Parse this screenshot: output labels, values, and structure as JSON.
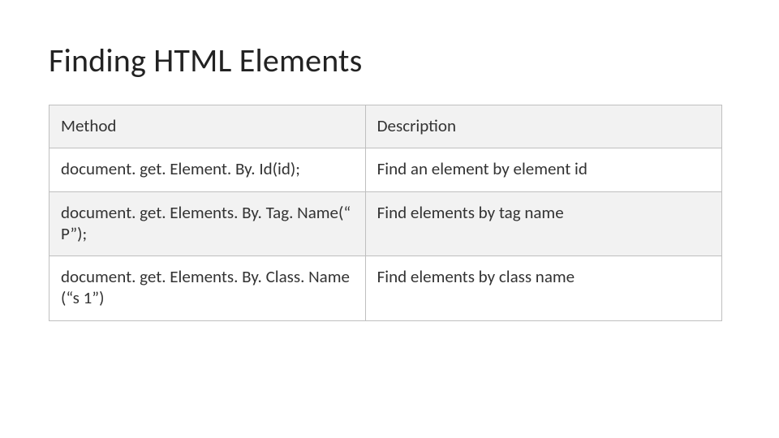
{
  "title": "Finding HTML Elements",
  "table": {
    "header": {
      "method": "Method",
      "description": "Description"
    },
    "rows": [
      {
        "method": "document. get. Element. By. Id(id);",
        "description": "Find an element by element id"
      },
      {
        "method": "document. get. Elements. By. Tag. Name(“ P”);",
        "description": "Find elements by tag name"
      },
      {
        "method": "document. get. Elements. By. Class. Name (“s 1”)",
        "description": "Find elements by class name"
      }
    ]
  }
}
